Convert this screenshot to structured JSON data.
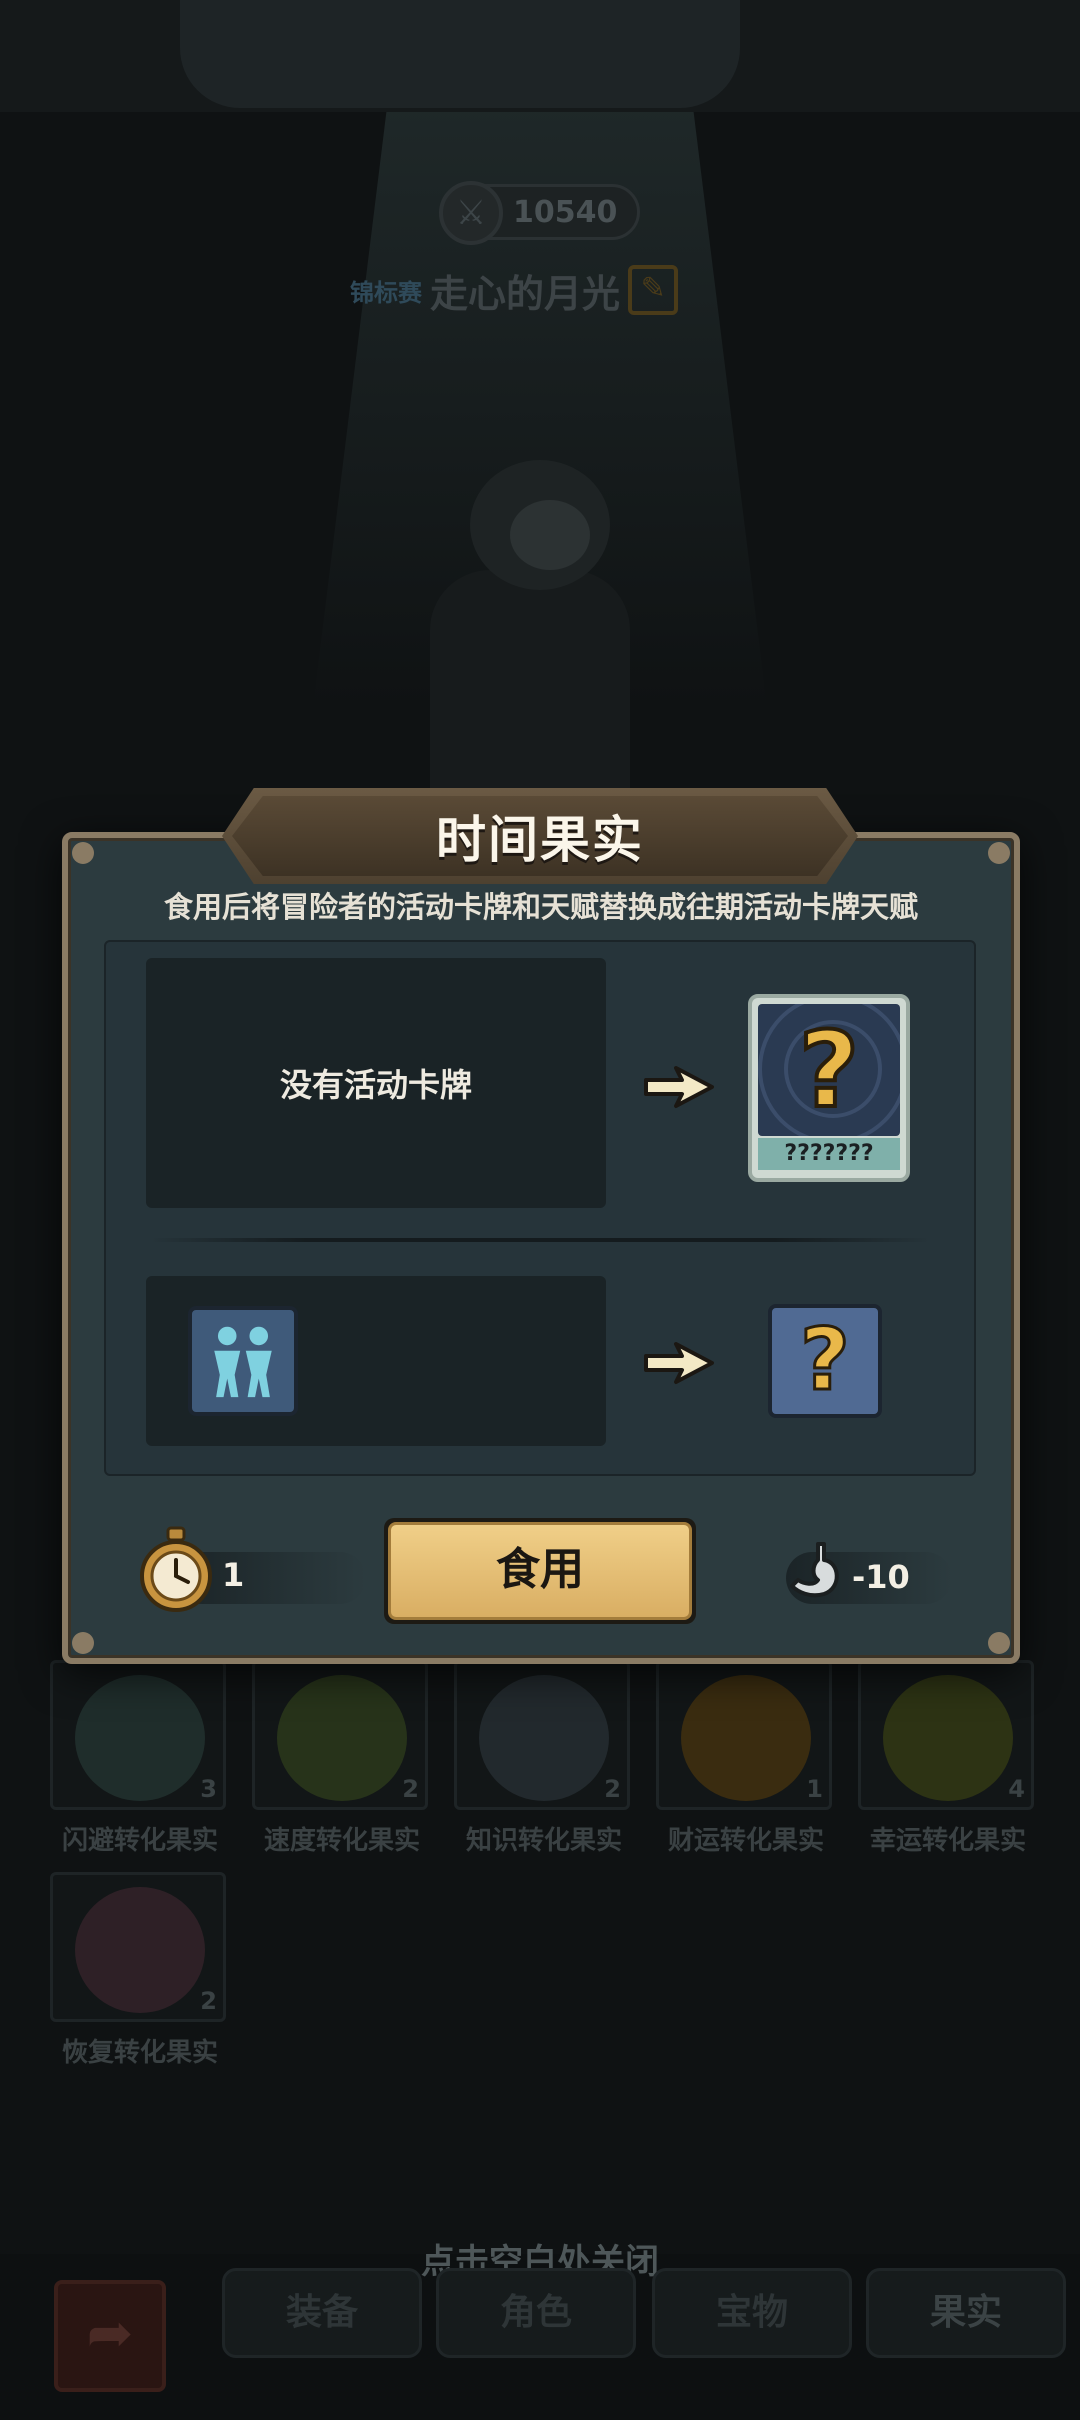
{
  "background": {
    "score": "10540",
    "league_badge": "锦标赛",
    "player_name": "走心的月光",
    "fruits": [
      {
        "label": "闪避转化果实",
        "count": "3",
        "color": "#3a5a55"
      },
      {
        "label": "速度转化果实",
        "count": "2",
        "color": "#4a6b22"
      },
      {
        "label": "知识转化果实",
        "count": "2",
        "color": "#3a4a55"
      },
      {
        "label": "财运转化果实",
        "count": "1",
        "color": "#7a5a12"
      },
      {
        "label": "幸运转化果实",
        "count": "4",
        "color": "#5a6a20"
      },
      {
        "label": "恢复转化果实",
        "count": "2",
        "color": "#5a3a48"
      }
    ],
    "close_hint": "点击空白处关闭",
    "tabs": [
      "装备",
      "角色",
      "宝物",
      "果实"
    ]
  },
  "modal": {
    "title": "时间果实",
    "description": "食用后将冒险者的活动卡牌和天赋替换成往期活动卡牌天赋",
    "card_row": {
      "current_text": "没有活动卡牌",
      "result_card_name": "???????",
      "result_card_symbol": "?"
    },
    "talent_row": {
      "current_icon": "twin-figures-icon",
      "result_symbol": "?"
    },
    "cost": {
      "item_icon": "pocket-watch-icon",
      "item_count": "1"
    },
    "eat_button_label": "食用",
    "hunger": {
      "icon": "stomach-icon",
      "value": "-10"
    }
  }
}
